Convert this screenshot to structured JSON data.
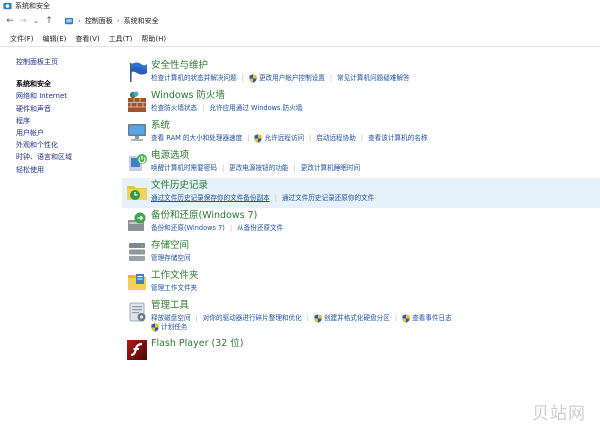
{
  "window": {
    "title": "系统和安全"
  },
  "address": {
    "breadcrumb": [
      "控制面板",
      "系统和安全"
    ]
  },
  "menu": [
    "文件(F)",
    "编辑(E)",
    "查看(V)",
    "工具(T)",
    "帮助(H)"
  ],
  "sidebar": {
    "home": "控制面板主页",
    "items": [
      "系统和安全",
      "网络和 Internet",
      "硬件和声音",
      "程序",
      "用户帐户",
      "外观和个性化",
      "时钟、语言和区域",
      "轻松使用"
    ]
  },
  "categories": [
    {
      "title": "安全性与维护",
      "icon": "flag-icon",
      "lines": [
        [
          {
            "text": "检查计算机的状态并解决问题"
          },
          {
            "text": "更改用户帐户控制设置",
            "shield": true
          },
          {
            "text": "常见计算机问题疑难解答"
          }
        ]
      ]
    },
    {
      "title": "Windows 防火墙",
      "icon": "firewall-icon",
      "lines": [
        [
          {
            "text": "检查防火墙状态"
          },
          {
            "text": "允许应用通过 Windows 防火墙"
          }
        ]
      ]
    },
    {
      "title": "系统",
      "icon": "computer-icon",
      "lines": [
        [
          {
            "text": "查看 RAM 的大小和处理器速度"
          },
          {
            "text": "允许远程访问",
            "shield": true
          },
          {
            "text": "启动远程协助"
          },
          {
            "text": "查看该计算机的名称"
          }
        ]
      ]
    },
    {
      "title": "电源选项",
      "icon": "power-icon",
      "lines": [
        [
          {
            "text": "唤醒计算机时需要密码"
          },
          {
            "text": "更改电源按钮的功能"
          },
          {
            "text": "更改计算机睡眠时间"
          }
        ]
      ]
    },
    {
      "title": "文件历史记录",
      "icon": "file-history-icon",
      "highlight": true,
      "lines": [
        [
          {
            "text": "通过文件历史记录保存你的文件备份副本",
            "underline": true
          },
          {
            "text": "通过文件历史记录还原你的文件"
          }
        ]
      ]
    },
    {
      "title": "备份和还原(Windows 7)",
      "icon": "backup-icon",
      "lines": [
        [
          {
            "text": "备份和还原(Windows 7)"
          },
          {
            "text": "从备份还原文件"
          }
        ]
      ]
    },
    {
      "title": "存储空间",
      "icon": "storage-icon",
      "lines": [
        [
          {
            "text": "管理存储空间"
          }
        ]
      ]
    },
    {
      "title": "工作文件夹",
      "icon": "folder-icon",
      "lines": [
        [
          {
            "text": "管理工作文件夹"
          }
        ]
      ]
    },
    {
      "title": "管理工具",
      "icon": "admin-tools-icon",
      "lines": [
        [
          {
            "text": "释放磁盘空间"
          },
          {
            "text": "对你的驱动器进行碎片整理和优化"
          },
          {
            "text": "创建并格式化硬盘分区",
            "shield": true
          },
          {
            "text": "查看事件日志",
            "shield": true
          }
        ],
        [
          {
            "text": "计划任务",
            "shield": true
          }
        ]
      ]
    },
    {
      "title": "Flash Player (32 位)",
      "icon": "flash-icon",
      "lines": []
    }
  ],
  "watermark": "贝站网"
}
